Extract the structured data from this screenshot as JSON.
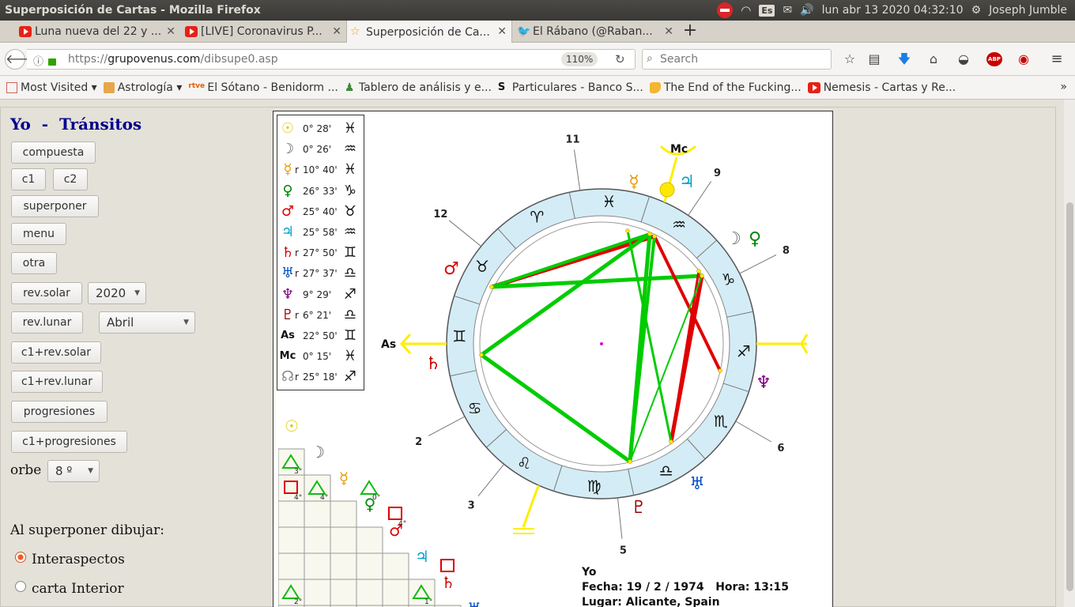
{
  "os_bar": {
    "window_title": "Superposición de Cartas - Mozilla Firefox",
    "keyboard_layout": "Es",
    "datetime": "lun abr 13 2020 04:32:10",
    "user": "Joseph Jumble"
  },
  "tabs": [
    {
      "label": "Luna nueva del 22 y ...",
      "icon": "youtube-icon"
    },
    {
      "label": "[LIVE] Coronavirus P...",
      "icon": "youtube-icon"
    },
    {
      "label": "Superposición de Ca...",
      "icon": "star-icon",
      "active": true
    },
    {
      "label": "El Rábano (@Raban...",
      "icon": "twitter-icon"
    }
  ],
  "nav": {
    "url_prefix": "https://",
    "url_host": "grupovenus.com",
    "url_path": "/dibsupe0.asp",
    "zoom": "110%",
    "search_placeholder": "Search"
  },
  "bookmarks": [
    {
      "label": "Most Visited",
      "dropdown": true
    },
    {
      "label": "Astrología",
      "dropdown": true
    },
    {
      "label": "El Sótano - Benidorm ..."
    },
    {
      "label": "Tablero de análisis y e..."
    },
    {
      "label": "Particulares - Banco S..."
    },
    {
      "label": "The End of the Fucking..."
    },
    {
      "label": "Nemesis - Cartas y Re..."
    }
  ],
  "sidebar": {
    "title": "Yo  -  Tránsitos",
    "buttons": {
      "compuesta": "compuesta",
      "c1": "c1",
      "c2": "c2",
      "superponer": "superponer",
      "menu": "menu",
      "otra": "otra",
      "rev_solar": "rev.solar",
      "rev_lunar": "rev.lunar",
      "c1_rev_solar": "c1+rev.solar",
      "c1_rev_lunar": "c1+rev.lunar",
      "progresiones": "progresiones",
      "c1_progresiones": "c1+progresiones"
    },
    "year_select": "2020",
    "month_select": "Abril",
    "orbe_label": "orbe",
    "orbe_select": "8 º",
    "draw_label": "Al superponer dibujar:",
    "radio_interaspectos": "Interaspectos",
    "radio_carta_interior": "carta Interior"
  },
  "planet_list": [
    {
      "symbol": "☉",
      "color": "#e0c800",
      "r": "",
      "deg": "0° 28'",
      "sign": "♓"
    },
    {
      "symbol": "☽",
      "color": "#555555",
      "r": "",
      "deg": "0° 26'",
      "sign": "♒"
    },
    {
      "symbol": "☿",
      "color": "#e89a00",
      "r": "r",
      "deg": "10° 40'",
      "sign": "♓"
    },
    {
      "symbol": "♀",
      "color": "#008800",
      "r": "",
      "deg": "26° 33'",
      "sign": "♑"
    },
    {
      "symbol": "♂",
      "color": "#dd0000",
      "r": "",
      "deg": "25° 40'",
      "sign": "♉"
    },
    {
      "symbol": "♃",
      "color": "#00a0c8",
      "r": "",
      "deg": "25° 58'",
      "sign": "♒"
    },
    {
      "symbol": "♄",
      "color": "#cc0000",
      "r": "r",
      "deg": "27° 50'",
      "sign": "♊"
    },
    {
      "symbol": "♅",
      "color": "#0050c8",
      "r": "r",
      "deg": "27° 37'",
      "sign": "♎"
    },
    {
      "symbol": "♆",
      "color": "#800080",
      "r": "",
      "deg": "9° 29'",
      "sign": "♐"
    },
    {
      "symbol": "♇",
      "color": "#990000",
      "r": "r",
      "deg": "6° 21'",
      "sign": "♎"
    },
    {
      "symbol": "As",
      "color": "#111111",
      "r": "",
      "deg": "22° 50'",
      "sign": "♊"
    },
    {
      "symbol": "Mc",
      "color": "#111111",
      "r": "",
      "deg": "0° 15'",
      "sign": "♓"
    },
    {
      "symbol": "☊",
      "color": "#888888",
      "r": "r",
      "deg": "25° 18'",
      "sign": "♐"
    }
  ],
  "wheel": {
    "signs": [
      "♈",
      "♉",
      "♊",
      "♋",
      "♌",
      "♍",
      "♎",
      "♏",
      "♐",
      "♑",
      "♒",
      "♓"
    ],
    "houses": [
      "11",
      "12",
      "9",
      "8",
      "2",
      "3",
      "6",
      "5"
    ],
    "axis_labels": {
      "asc": "As",
      "mc": "Mc"
    },
    "colors": {
      "ring": "#d4ecf6",
      "hard": "#e00000",
      "soft": "#00cc00",
      "axis": "#ffee00"
    }
  },
  "aspect_grid": {
    "orbs": [
      "3°",
      "4°",
      "4°",
      "0°",
      "4°",
      "0°",
      "2°",
      "1°"
    ]
  },
  "chart_info": {
    "name": "Yo",
    "date": "Fecha: 19 / 2 / 1974",
    "time": "Hora: 13:15",
    "place": "Lugar: Alicante, Spain"
  }
}
